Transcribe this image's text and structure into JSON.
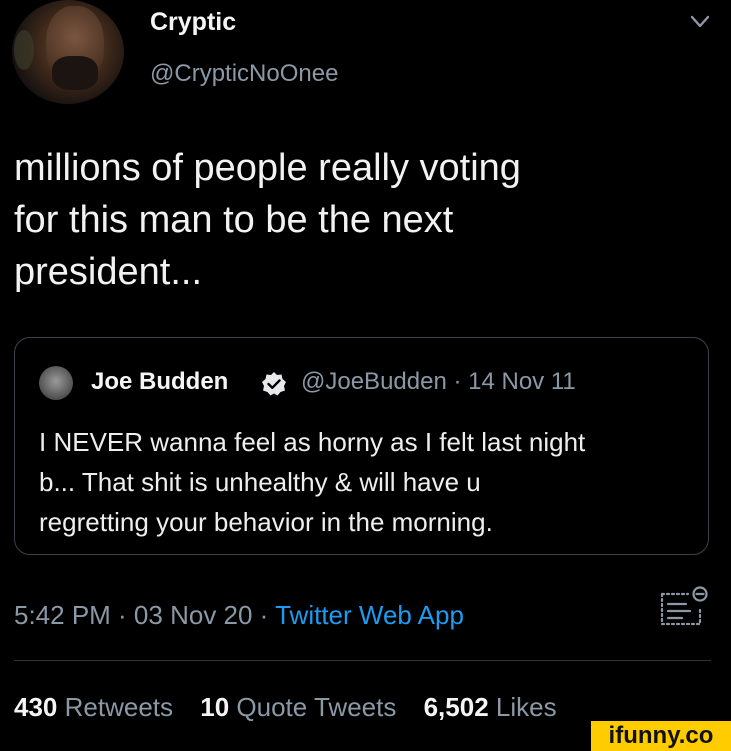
{
  "user": {
    "name": "Cryptic",
    "handle": "@CrypticNoOnee"
  },
  "tweet": {
    "text_lines": [
      "millions of people really voting",
      "for this man to be the next",
      "president..."
    ]
  },
  "quoted_tweet": {
    "name": "Joe Budden",
    "handle_date": "@JoeBudden · 14 Nov 11",
    "text_lines": [
      "I NEVER wanna feel as horny as I felt last night",
      "b... That shit is unhealthy & will have u",
      "regretting your behavior in the morning."
    ]
  },
  "meta": {
    "time_date": "5:42 PM · 03 Nov 20 · ",
    "source": "Twitter Web App"
  },
  "stats": {
    "retweets_count": "430",
    "retweets_label": "Retweets",
    "quotes_count": "10",
    "quotes_label": "Quote Tweets",
    "likes_count": "6,502",
    "likes_label": "Likes"
  },
  "watermark": "ifunny.co",
  "colors": {
    "background": "#000000",
    "link": "#1d9bf0",
    "secondary_text": "#8b98a5",
    "border": "#3b4248"
  },
  "icons": {
    "chevron": "chevron-down-icon",
    "verified": "verified-badge-icon",
    "analytics": "analytics-icon"
  }
}
